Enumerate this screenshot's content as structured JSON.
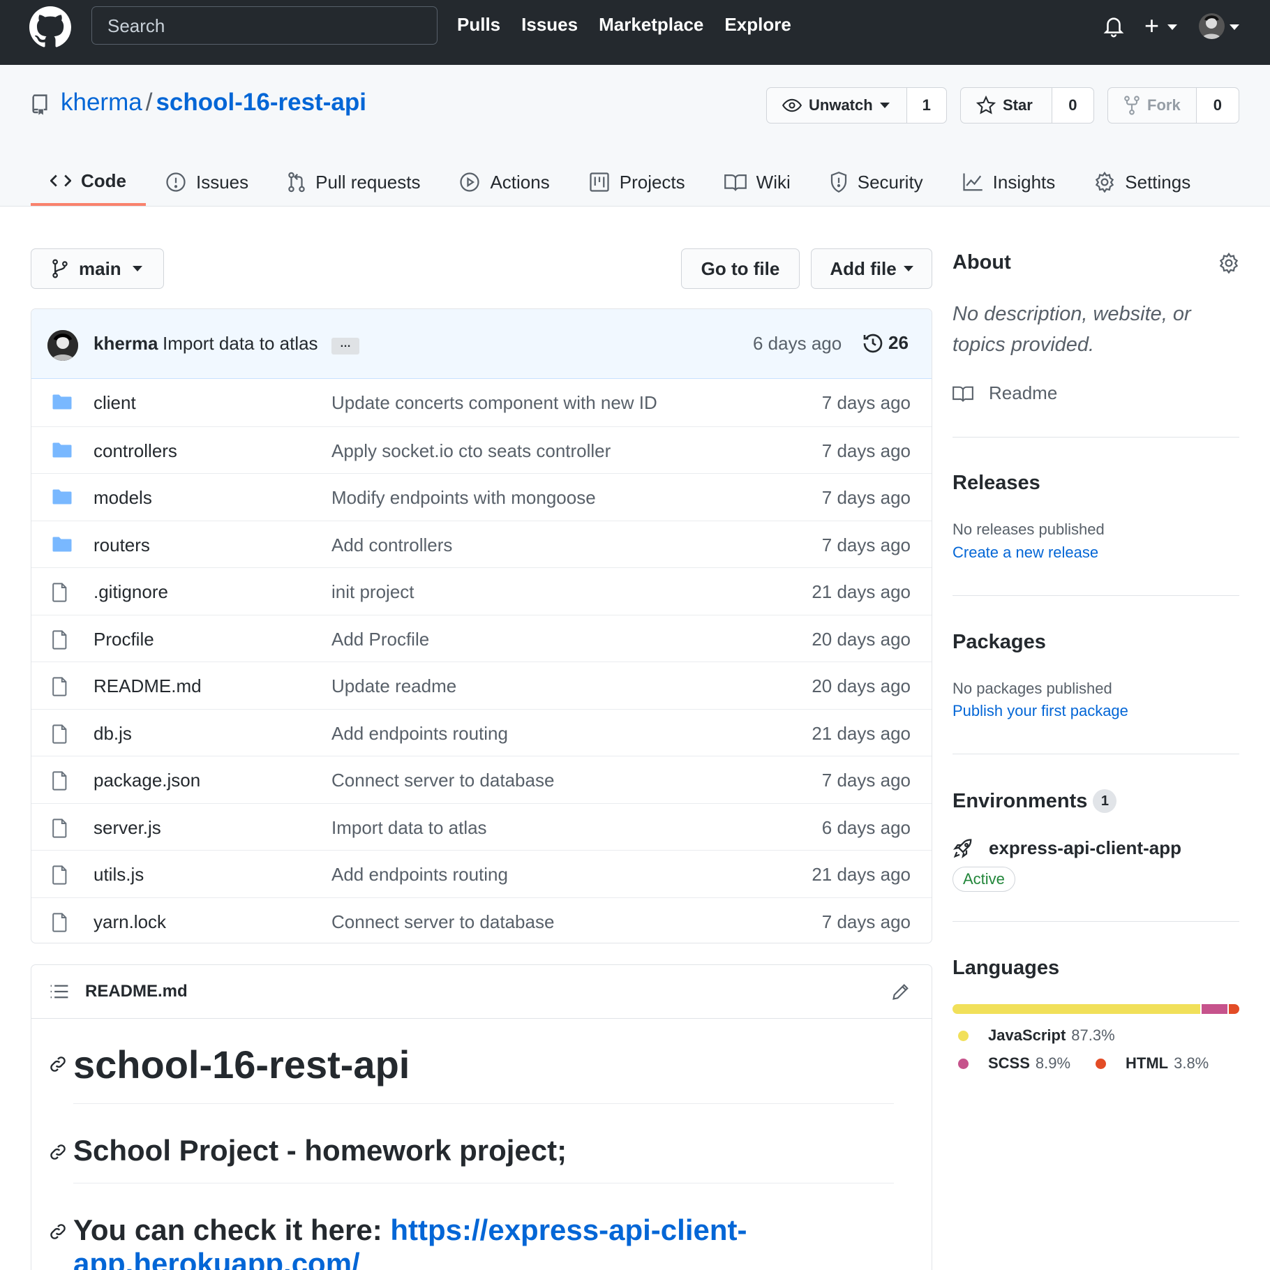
{
  "header": {
    "search_placeholder": "Search",
    "nav": [
      "Pulls",
      "Issues",
      "Marketplace",
      "Explore"
    ]
  },
  "repo": {
    "owner": "kherma",
    "name": "school-16-rest-api",
    "watch_label": "Unwatch",
    "watch_count": "1",
    "star_label": "Star",
    "star_count": "0",
    "fork_label": "Fork",
    "fork_count": "0"
  },
  "tabs": [
    {
      "label": "Code",
      "icon": "code-icon"
    },
    {
      "label": "Issues",
      "icon": "issue-icon"
    },
    {
      "label": "Pull requests",
      "icon": "pull-request-icon"
    },
    {
      "label": "Actions",
      "icon": "play-icon"
    },
    {
      "label": "Projects",
      "icon": "project-icon"
    },
    {
      "label": "Wiki",
      "icon": "book-icon"
    },
    {
      "label": "Security",
      "icon": "shield-icon"
    },
    {
      "label": "Insights",
      "icon": "graph-icon"
    },
    {
      "label": "Settings",
      "icon": "gear-icon"
    }
  ],
  "branch": {
    "name": "main",
    "go_to_file": "Go to file",
    "add_file": "Add file"
  },
  "latest_commit": {
    "author": "kherma",
    "message": "Import data to atlas",
    "ellipsis": "…",
    "time": "6 days ago",
    "count": "26"
  },
  "files": [
    {
      "type": "dir",
      "name": "client",
      "message": "Update concerts component with new ID",
      "age": "7 days ago"
    },
    {
      "type": "dir",
      "name": "controllers",
      "message": "Apply socket.io cto seats controller",
      "age": "7 days ago"
    },
    {
      "type": "dir",
      "name": "models",
      "message": "Modify endpoints with mongoose",
      "age": "7 days ago"
    },
    {
      "type": "dir",
      "name": "routers",
      "message": "Add controllers",
      "age": "7 days ago"
    },
    {
      "type": "file",
      "name": ".gitignore",
      "message": "init project",
      "age": "21 days ago"
    },
    {
      "type": "file",
      "name": "Procfile",
      "message": "Add Procfile",
      "age": "20 days ago"
    },
    {
      "type": "file",
      "name": "README.md",
      "message": "Update readme",
      "age": "20 days ago"
    },
    {
      "type": "file",
      "name": "db.js",
      "message": "Add endpoints routing",
      "age": "21 days ago"
    },
    {
      "type": "file",
      "name": "package.json",
      "message": "Connect server to database",
      "age": "7 days ago"
    },
    {
      "type": "file",
      "name": "server.js",
      "message": "Import data to atlas",
      "age": "6 days ago"
    },
    {
      "type": "file",
      "name": "utils.js",
      "message": "Add endpoints routing",
      "age": "21 days ago"
    },
    {
      "type": "file",
      "name": "yarn.lock",
      "message": "Connect server to database",
      "age": "7 days ago"
    }
  ],
  "readme": {
    "filename": "README.md",
    "h1": "school-16-rest-api",
    "h2": "School Project - homework project;",
    "h3_prefix": "You can check it here: ",
    "h3_link_1": "https://express-api-client-",
    "h3_link_2": "app.herokuapp.com/"
  },
  "sidebar": {
    "about_title": "About",
    "about_desc": "No description, website, or topics provided.",
    "readme_label": "Readme",
    "releases_title": "Releases",
    "releases_none": "No releases published",
    "releases_link": "Create a new release",
    "packages_title": "Packages",
    "packages_none": "No packages published",
    "packages_link": "Publish your first package",
    "env_title": "Environments",
    "env_count": "1",
    "env_name": "express-api-client-app",
    "env_status": "Active",
    "languages_title": "Languages",
    "languages": [
      {
        "name": "JavaScript",
        "percent": "87.3%",
        "value": 87.3,
        "color": "#f1e05a"
      },
      {
        "name": "SCSS",
        "percent": "8.9%",
        "value": 8.9,
        "color": "#c6538c"
      },
      {
        "name": "HTML",
        "percent": "3.8%",
        "value": 3.8,
        "color": "#e34c26"
      }
    ]
  }
}
